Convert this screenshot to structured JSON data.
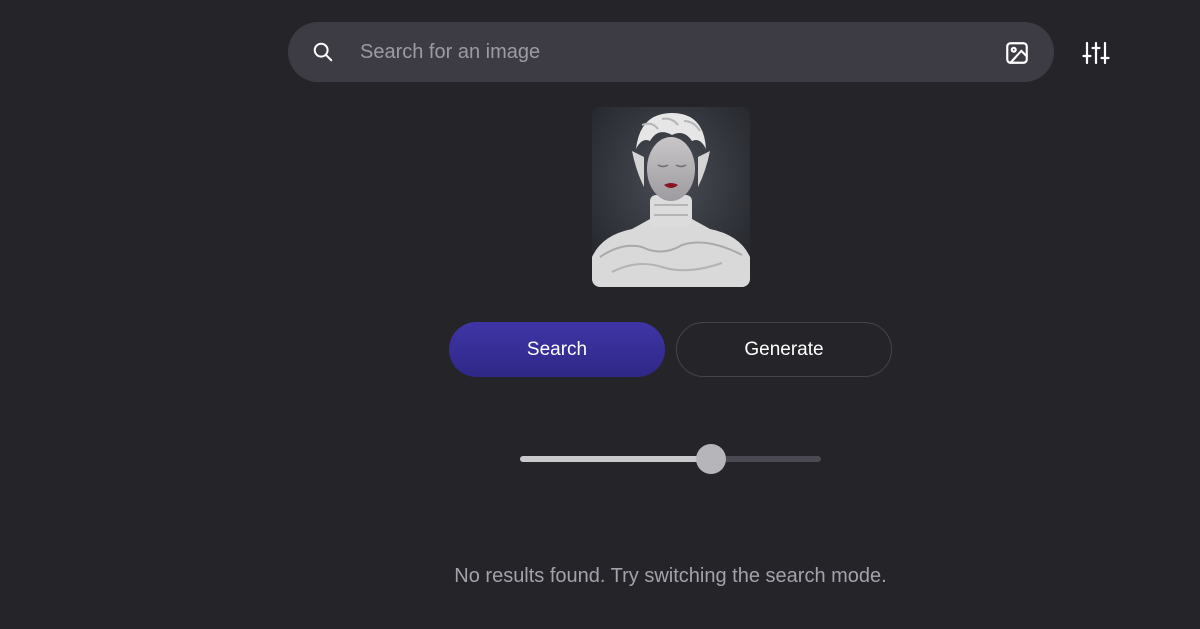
{
  "search": {
    "placeholder": "Search for an image",
    "value": "",
    "icon": "search-icon",
    "image_search_icon": "image-icon"
  },
  "filters": {
    "icon": "sliders-icon"
  },
  "preview": {
    "icon": "uploaded-image"
  },
  "actions": {
    "search_label": "Search",
    "generate_label": "Generate"
  },
  "slider": {
    "value": 0.635
  },
  "results": {
    "message": "No results found. Try switching the search mode."
  },
  "colors": {
    "background": "#252429",
    "search_bar": "#3d3c44",
    "primary_button": "#3a31a0",
    "text_muted": "#a3a2ab"
  }
}
